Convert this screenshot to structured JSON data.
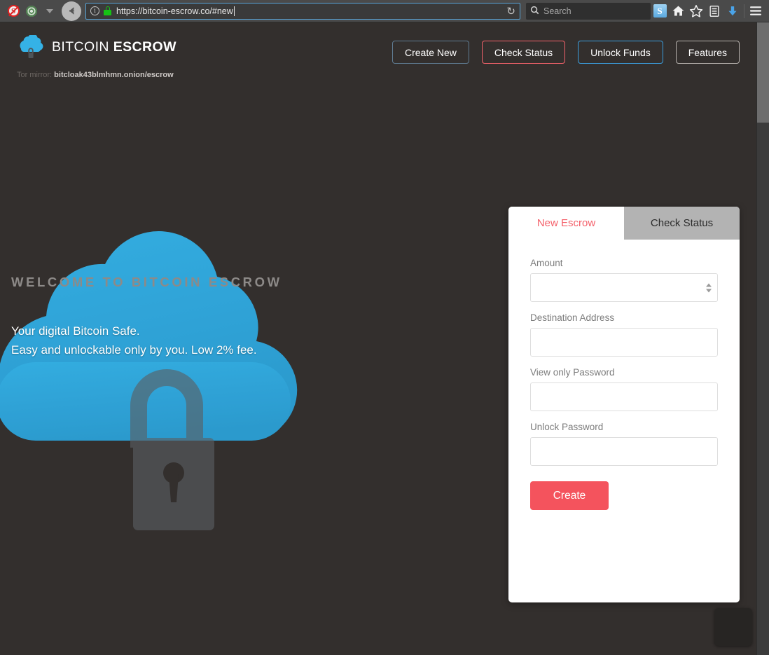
{
  "browser": {
    "icons": {
      "noscript": "noscript-icon",
      "onion": "tor-onion-icon",
      "dropdown": "chevron-down-icon",
      "back": "back-arrow-icon",
      "info": "site-info-icon",
      "lock": "https-lock-icon",
      "reload": "reload-icon",
      "search": "search-icon",
      "s_badge": "s-extension-icon",
      "home": "home-icon",
      "bookmark": "star-icon",
      "library": "library-icon",
      "downloads": "download-arrow-icon",
      "menu": "hamburger-menu-icon"
    },
    "noscript_letter": "S",
    "s_badge_letter": "S",
    "info_letter": "i",
    "reload_glyph": "↻",
    "search_glyph": "⌕",
    "url": "https://bitcoin-escrow.co/#new",
    "search_placeholder": "Search"
  },
  "site": {
    "brand": {
      "word1": "BITCOIN",
      "word2": "ESCROW",
      "logo": "cloud-lock-logo"
    },
    "tor_mirror": {
      "label": "Tor mirror:",
      "value": "bitcloak43blmhmn.onion/escrow"
    },
    "nav": [
      {
        "label": "Create New",
        "style": "b-slate"
      },
      {
        "label": "Check Status",
        "style": "b-red"
      },
      {
        "label": "Unlock Funds",
        "style": "b-blue"
      },
      {
        "label": "Features",
        "style": "b-gray"
      }
    ],
    "hero": {
      "kicker": "WELCOME TO BITCOIN ESCROW",
      "line1": "Your digital Bitcoin Safe.",
      "line2": "Easy and unlockable only by you. Low 2% fee."
    },
    "card": {
      "tabs": [
        {
          "label": "New Escrow",
          "active": true
        },
        {
          "label": "Check Status",
          "active": false
        }
      ],
      "fields": [
        {
          "label": "Amount",
          "value": "",
          "placeholder": "",
          "type": "number"
        },
        {
          "label": "Destination Address",
          "value": "",
          "placeholder": "",
          "type": "text"
        },
        {
          "label": "View only Password",
          "value": "",
          "placeholder": "",
          "type": "password"
        },
        {
          "label": "Unlock Password",
          "value": "",
          "placeholder": "",
          "type": "password"
        }
      ],
      "submit_label": "Create"
    }
  },
  "colors": {
    "accent_red": "#f4535d",
    "accent_blue": "#3b9ede",
    "cloud_blue": "#2eaae2",
    "page_bg": "#332f2d",
    "card_bg": "#ffffff",
    "tab_inactive_bg": "#b3b3b3"
  }
}
